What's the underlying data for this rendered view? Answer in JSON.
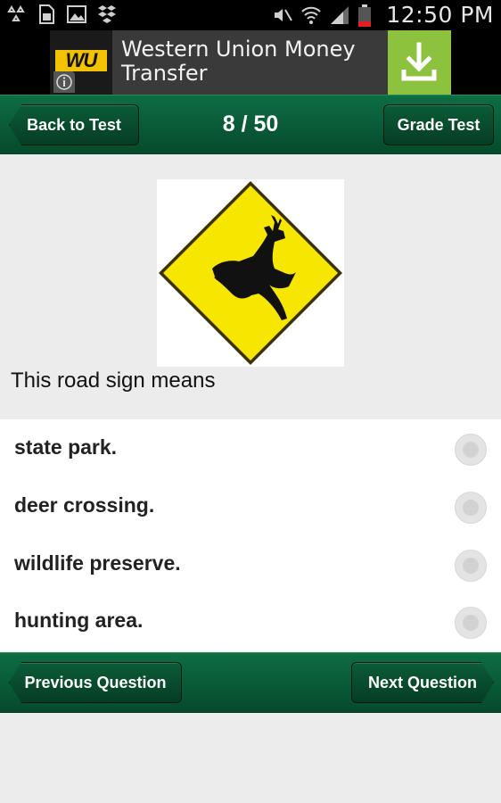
{
  "status_bar": {
    "time": "12:50 PM",
    "icons": [
      "recycle-icon",
      "sim-card-icon",
      "image-icon",
      "dropbox-icon",
      "mute-icon",
      "wifi-icon",
      "signal-icon",
      "battery-icon"
    ]
  },
  "ad": {
    "logo_text": "WU",
    "title": "Western Union Money Transfer",
    "icons": [
      "info-icon",
      "download-icon"
    ],
    "colors": {
      "download_bg": "#8dc23f",
      "logo_bg": "#f2c200"
    }
  },
  "header": {
    "back_label": "Back to Test",
    "counter": "8 / 50",
    "grade_label": "Grade Test"
  },
  "question": {
    "image": "deer-crossing-sign-icon",
    "text": "This road sign means"
  },
  "answers": [
    {
      "label": "state park."
    },
    {
      "label": "deer crossing."
    },
    {
      "label": "wildlife preserve."
    },
    {
      "label": "hunting area."
    }
  ],
  "footer": {
    "prev_label": "Previous Question",
    "next_label": "Next Question"
  },
  "colors": {
    "bar_green": "#0d6d43",
    "sign_yellow": "#f7e600"
  }
}
